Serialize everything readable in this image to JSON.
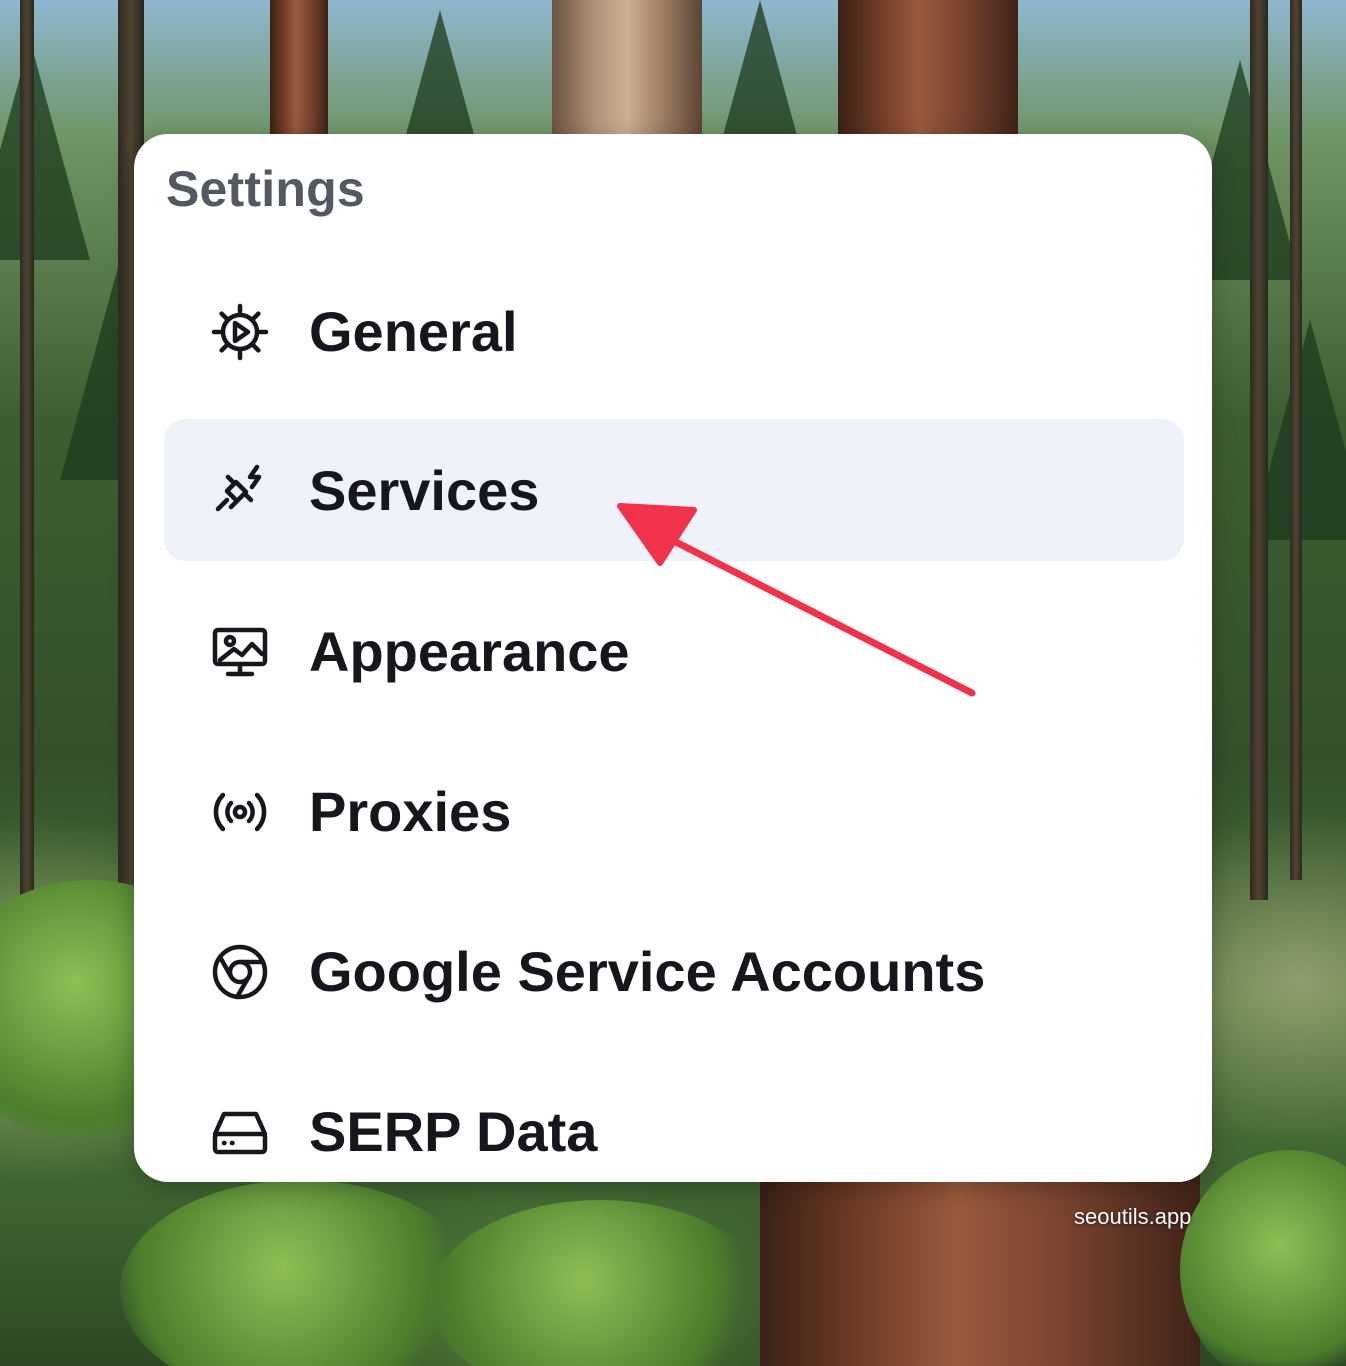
{
  "settings": {
    "title": "Settings",
    "items": [
      {
        "label": "General",
        "icon": "gear-icon",
        "active": false
      },
      {
        "label": "Services",
        "icon": "plug-icon",
        "active": true
      },
      {
        "label": "Appearance",
        "icon": "display-icon",
        "active": false
      },
      {
        "label": "Proxies",
        "icon": "broadcast-icon",
        "active": false
      },
      {
        "label": "Google Service Accounts",
        "icon": "chrome-icon",
        "active": false
      },
      {
        "label": "SERP Data",
        "icon": "hard-drive-icon",
        "active": false
      }
    ]
  },
  "annotation": {
    "icon": "pointer-arrow-icon",
    "color": "#f0334a"
  },
  "watermark": "seoutils.app",
  "colors": {
    "panel_background": "#ffffff",
    "active_item_background": "#eff2f8",
    "title_text": "#545862",
    "item_text": "#15171c"
  }
}
